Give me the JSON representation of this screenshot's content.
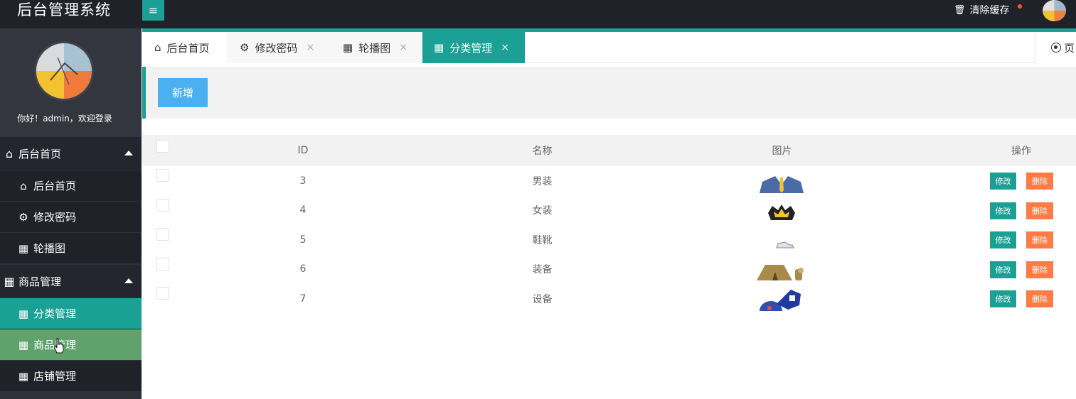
{
  "app": {
    "title": "后台管理系统",
    "menu_toggle": "≡",
    "clear_cache": "清除缓存",
    "trash_icon": "🗑"
  },
  "user": {
    "greeting": "你好！admin，欢迎登录"
  },
  "sidebar": {
    "groups": [
      {
        "label": "后台首页",
        "icon": "⌂",
        "items": [
          {
            "label": "后台首页",
            "icon": "⌂"
          },
          {
            "label": "修改密码",
            "icon": "⚙"
          },
          {
            "label": "轮播图",
            "icon": "▦"
          }
        ]
      },
      {
        "label": "商品管理",
        "icon": "▦",
        "items": [
          {
            "label": "分类管理",
            "icon": "▦"
          },
          {
            "label": "商品管理",
            "icon": "▦"
          },
          {
            "label": "店铺管理",
            "icon": "▦"
          }
        ]
      }
    ]
  },
  "tabs": [
    {
      "label": "后台首页",
      "icon": "⌂"
    },
    {
      "label": "修改密码",
      "icon": "⚙",
      "close": "×"
    },
    {
      "label": "轮播图",
      "icon": "▦",
      "close": "×"
    },
    {
      "label": "分类管理",
      "icon": "▦",
      "close": "×"
    }
  ],
  "tab_right_label": "页",
  "toolbar": {
    "add_label": "新增"
  },
  "table": {
    "headers": [
      "ID",
      "名称",
      "图片",
      "操作"
    ],
    "edit_label": "修改",
    "delete_label": "删除",
    "rows": [
      {
        "id": "3",
        "name": "男装",
        "image": "suit-image"
      },
      {
        "id": "4",
        "name": "女装",
        "image": "crown-top-image"
      },
      {
        "id": "5",
        "name": "鞋靴",
        "image": "shoe-image"
      },
      {
        "id": "6",
        "name": "装备",
        "image": "tent-image"
      },
      {
        "id": "7",
        "name": "设备",
        "image": "device-image"
      }
    ]
  },
  "colors": {
    "topbar": "#1f2229",
    "sidebar": "#2f323a",
    "accent": "#1aa094",
    "add_button": "#4ab0ef",
    "delete_button": "#ff7a45"
  }
}
